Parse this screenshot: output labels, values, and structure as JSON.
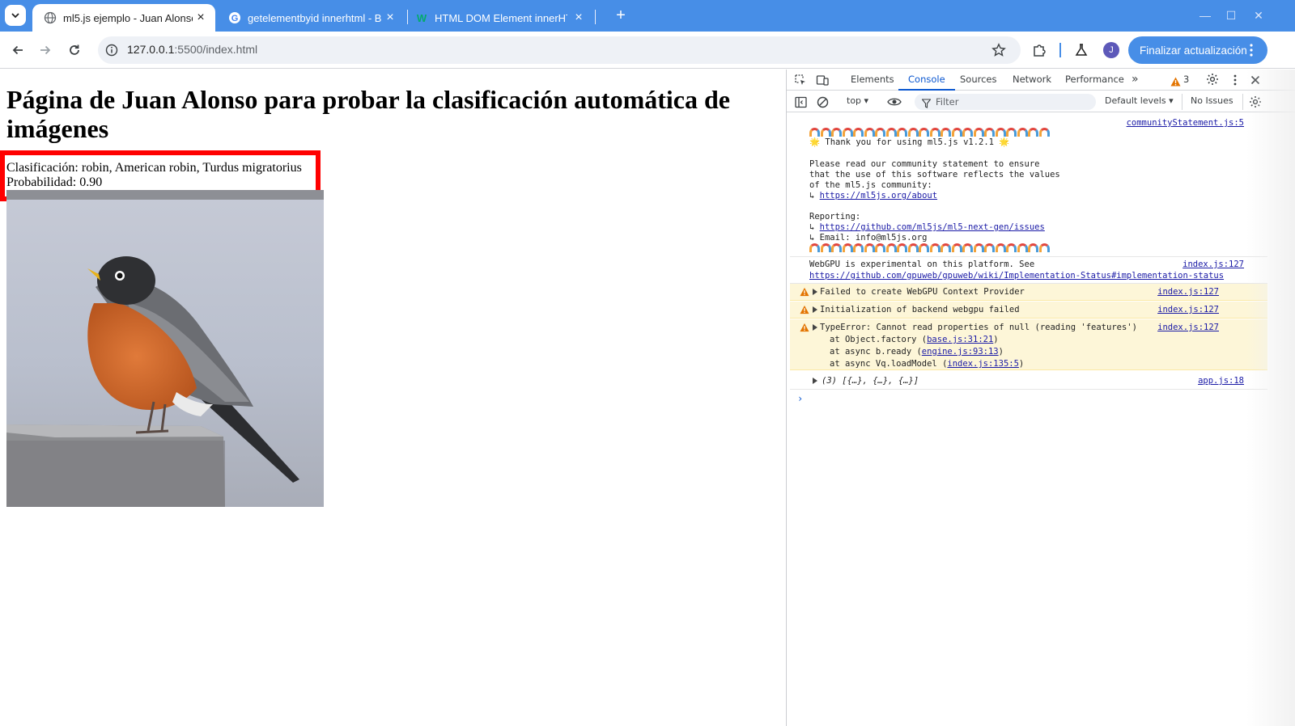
{
  "browser": {
    "tabs": [
      {
        "title": "ml5.js ejemplo - Juan Alonso",
        "icon": "globe-icon",
        "active": true
      },
      {
        "title": "getelementbyid innerhtml - B",
        "icon": "google-icon",
        "active": false
      },
      {
        "title": "HTML DOM Element innerHT",
        "icon": "w3schools-icon",
        "active": false
      }
    ],
    "url_host": "127.0.0.1",
    "url_rest": ":5500/index.html",
    "avatar_letter": "J",
    "update_label": "Finalizar actualización"
  },
  "page": {
    "heading": "Página de Juan Alonso para probar la clasificación automática de imágenes",
    "classification": "Clasificación: robin, American robin, Turdus migratorius",
    "probability": "Probabilidad: 0.90"
  },
  "devtools": {
    "tabs": [
      "Elements",
      "Console",
      "Sources",
      "Network",
      "Performance"
    ],
    "active_tab": "Console",
    "warning_count": "3",
    "context": "top",
    "filter_placeholder": "Filter",
    "levels": "Default levels",
    "issues": "No Issues",
    "console": {
      "community": {
        "source": "communityStatement.js:5",
        "thanks": "🌟 Thank you for using ml5.js v1.2.1 🌟",
        "read1": "Please read our community statement to ensure",
        "read2": "that the use of this software reflects the values",
        "read3": "of the ml5.js community:",
        "about_link": "https://ml5js.org/about",
        "reporting": "Reporting:",
        "issues_link": "https://github.com/ml5js/ml5-next-gen/issues",
        "email": "↳ Email: info@ml5js.org"
      },
      "webgpu_msg": "WebGPU is experimental on this platform. See",
      "webgpu_link": "https://github.com/gpuweb/gpuweb/wiki/Implementation-Status#implementation-status",
      "webgpu_src": "index.js:127",
      "warnings": [
        {
          "text": "Failed to create WebGPU Context Provider",
          "src": "index.js:127"
        },
        {
          "text": "Initialization of backend webgpu failed",
          "src": "index.js:127"
        }
      ],
      "type_error": {
        "text": "TypeError: Cannot read properties of null (reading 'features')",
        "src": "index.js:127",
        "stack": [
          {
            "pre": "at Object.factory (",
            "link": "base.js:31:21",
            "post": ")"
          },
          {
            "pre": "at async b.ready (",
            "link": "engine.js:93:13",
            "post": ")"
          },
          {
            "pre": "at async Vq.loadModel (",
            "link": "index.js:135:5",
            "post": ")"
          }
        ]
      },
      "result_line": "(3) [{…}, {…}, {…}]",
      "result_src": "app.js:18"
    }
  }
}
